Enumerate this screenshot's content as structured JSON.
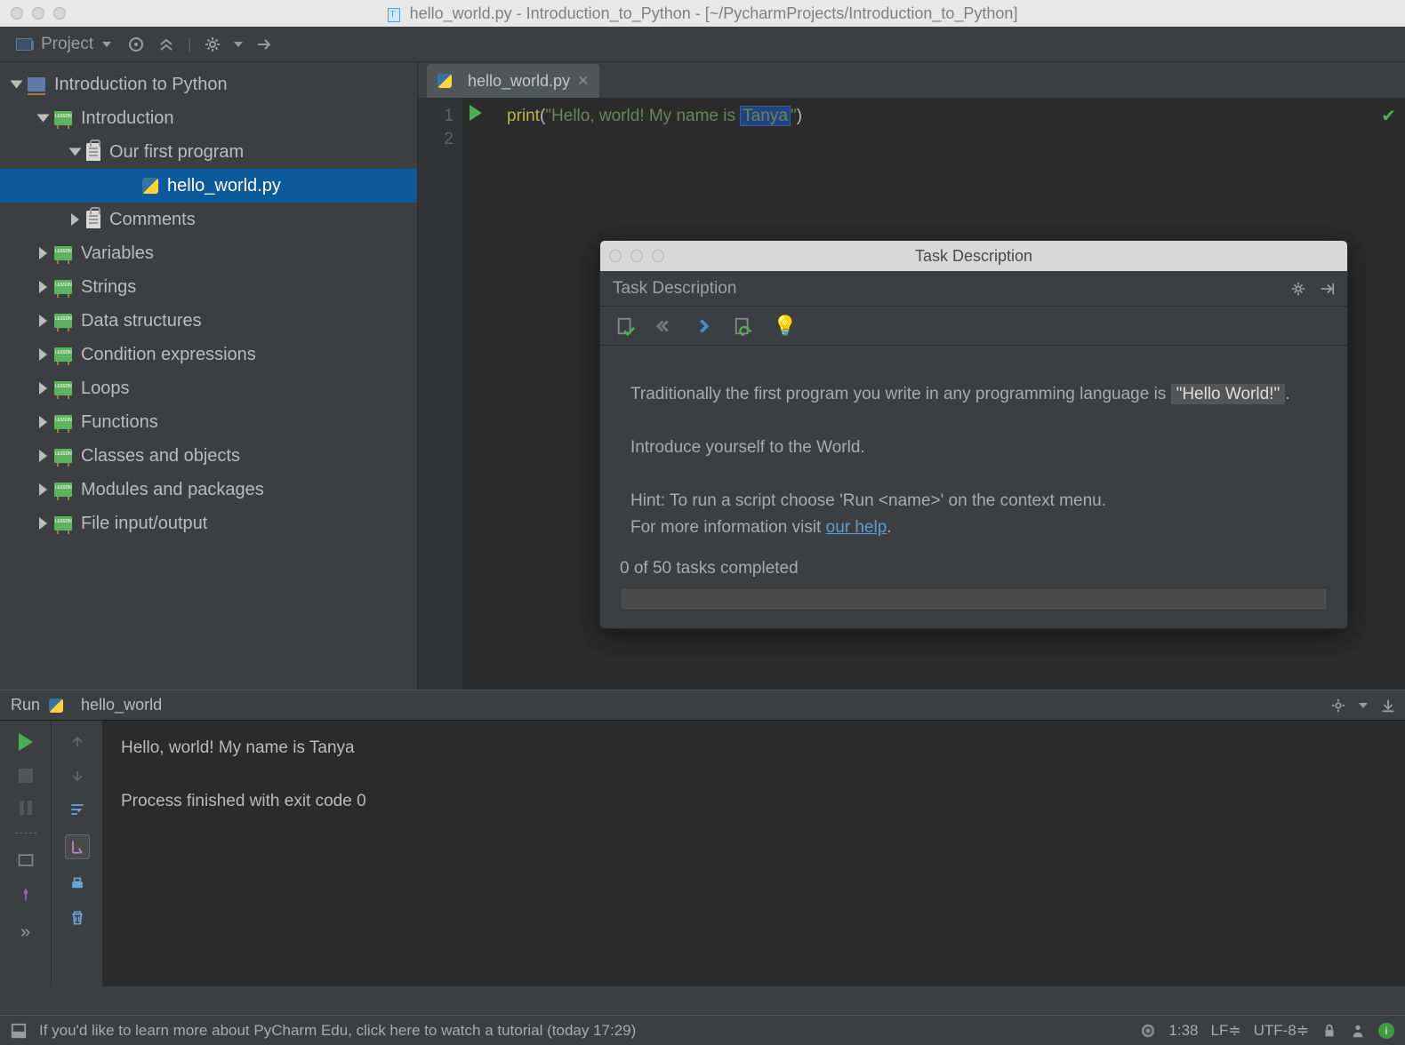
{
  "window": {
    "title": "hello_world.py - Introduction_to_Python - [~/PycharmProjects/Introduction_to_Python]"
  },
  "project_panel": {
    "label": "Project"
  },
  "tree": {
    "root": "Introduction to Python",
    "intro": "Introduction",
    "first_program": "Our first program",
    "hello_file": "hello_world.py",
    "comments": "Comments",
    "lessons": [
      "Variables",
      "Strings",
      "Data structures",
      "Condition expressions",
      "Loops",
      "Functions",
      "Classes and objects",
      "Modules and packages",
      "File input/output"
    ]
  },
  "tab": {
    "filename": "hello_world.py"
  },
  "code": {
    "line1_fn": "print",
    "line1_open": "(",
    "line1_str_a": "\"Hello, world! My name is ",
    "line1_hl": "Tanya",
    "line1_str_b": "\"",
    "line1_close": ")",
    "gutter": [
      "1",
      "2"
    ]
  },
  "run": {
    "tab_label": "Run",
    "script_name": "hello_world",
    "output_line1": "Hello, world! My name is Tanya",
    "output_line2": "Process finished with exit code 0"
  },
  "task_popup": {
    "title": "Task Description",
    "subtitle": "Task Description",
    "p1a": "Traditionally the first program you write in any programming language is ",
    "p1_code": "\"Hello World!\"",
    "p1b": ".",
    "p2": "Introduce yourself to the World.",
    "p3a": "Hint: To run a script choose 'Run <name>' on the context menu.",
    "p3b": "For more information visit ",
    "p3_link": "our help",
    "p3c": ".",
    "progress": "0 of 50 tasks completed"
  },
  "statusbar": {
    "msg": "If you'd like to learn more about PyCharm Edu, click here to watch a tutorial (today 17:29)",
    "pos": "1:38",
    "lf": "LF",
    "enc": "UTF-8"
  }
}
